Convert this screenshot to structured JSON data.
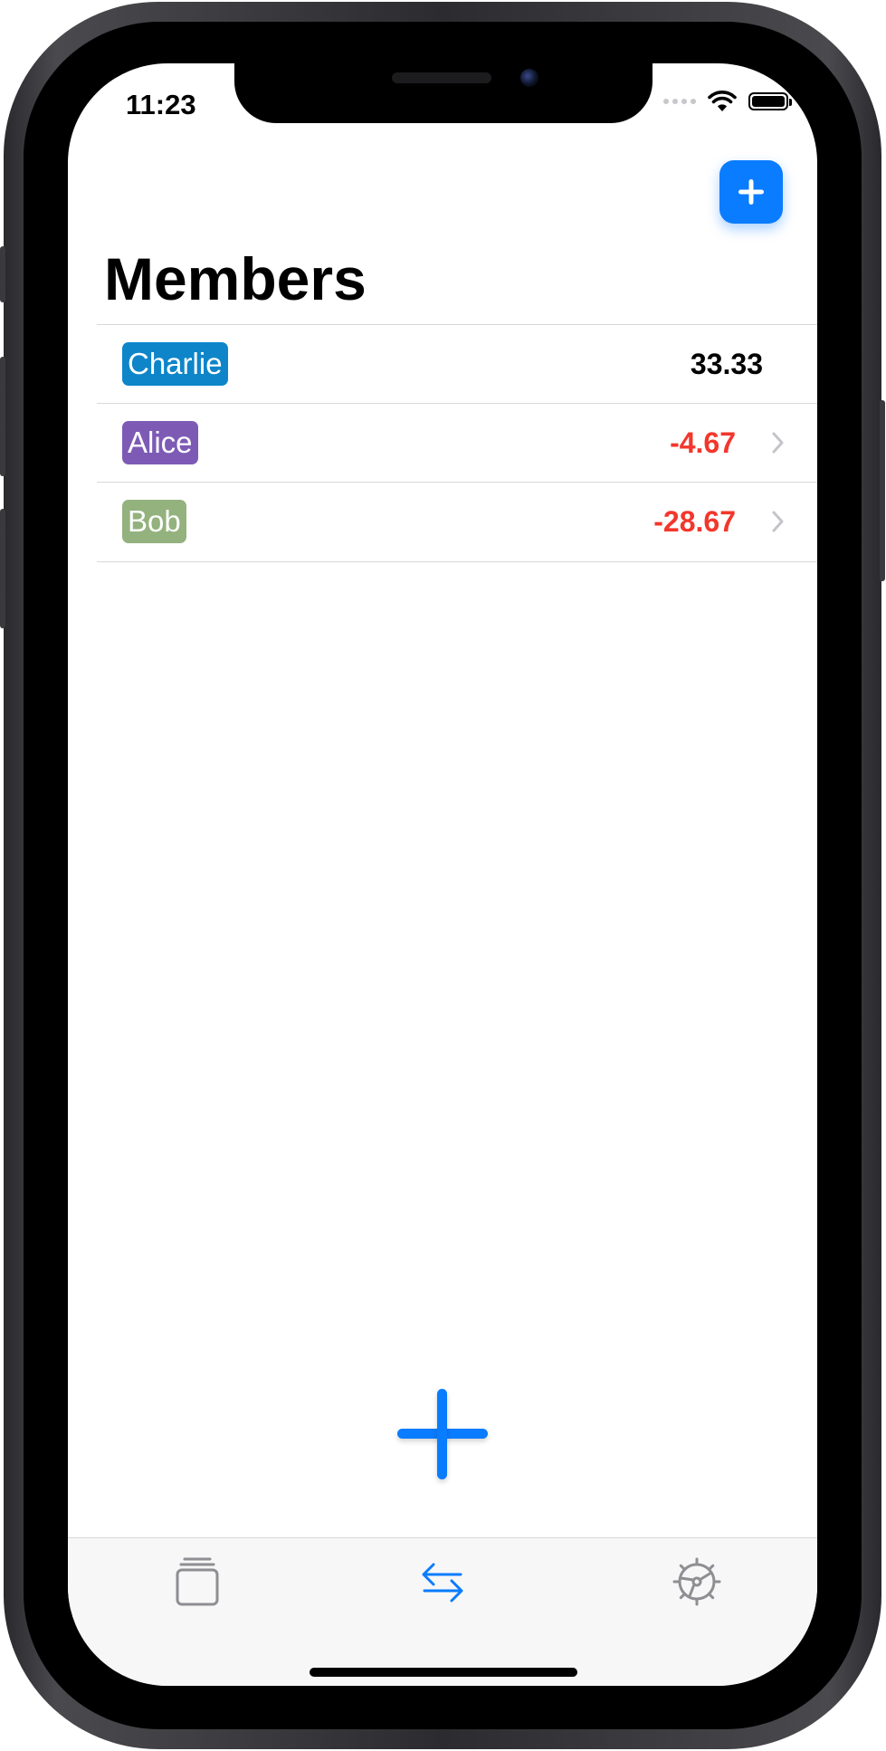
{
  "status_bar": {
    "time": "11:23",
    "signal_icon": "cellular-signal-icon",
    "wifi_icon": "wifi-icon",
    "battery_icon": "battery-icon"
  },
  "header": {
    "title": "Members",
    "add_button_icon": "plus-icon",
    "add_button_label": "+"
  },
  "members": [
    {
      "name": "Charlie",
      "amount": "33.33",
      "tag_color": "#0e85c9",
      "amount_color": "#000000",
      "chevron": false
    },
    {
      "name": "Alice",
      "amount": "-4.67",
      "tag_color": "#7d5bb5",
      "amount_color": "#f2372c",
      "chevron": true
    },
    {
      "name": "Bob",
      "amount": "-28.67",
      "tag_color": "#93b27d",
      "amount_color": "#f2372c",
      "chevron": true
    }
  ],
  "floating_add_icon": "plus-icon",
  "tab_bar": {
    "tabs": [
      {
        "icon": "stack-icon",
        "selected": false
      },
      {
        "icon": "transfer-arrows-icon",
        "selected": true
      },
      {
        "icon": "settings-gear-icon",
        "selected": false
      }
    ]
  },
  "colors": {
    "accent": "#0a7cff",
    "negative": "#f2372c",
    "tab_inactive": "#8e8e93"
  }
}
